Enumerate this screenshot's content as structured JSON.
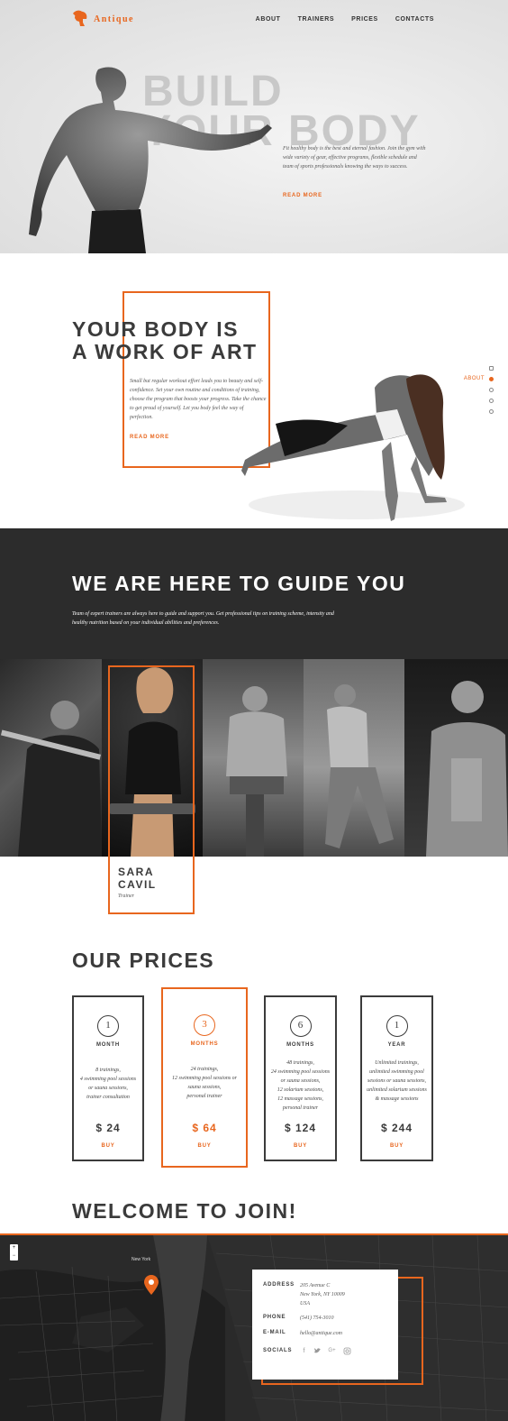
{
  "brand": {
    "name": "Antique",
    "accent": "#e8661e"
  },
  "nav": {
    "items": [
      "ABOUT",
      "TRAINERS",
      "PRICES",
      "CONTACTS"
    ]
  },
  "hero": {
    "line1": "BUILD",
    "line2": "YOUR BODY",
    "text": "Fit healthy body is the best and eternal fashion. Join the gym with wide variety of gear, effective programs, flexible schedule and team of sports professionals knowing the ways to success.",
    "read_more": "READ MORE"
  },
  "about": {
    "title_line1": "YOUR BODY IS",
    "title_line2": "A WORK OF ART",
    "text": "Small but regular workout effort leads you to beauty and self-confidence. Set your own routine and conditions of training, choose the program that boosts your progress. Take the chance to get proud of yourself. Let you body feel the way of perfection.",
    "read_more": "READ MORE",
    "section_nav_label": "ABOUT"
  },
  "guide": {
    "title": "WE ARE HERE TO GUIDE YOU",
    "text": "Team of expert trainers are always here to guide and support you. Get professional tips on training scheme, intensity and healthy nutrition based on your individual abilities and preferences."
  },
  "trainer": {
    "first": "SARA",
    "last": "CAVIL",
    "role": "Trainer"
  },
  "prices": {
    "title": "OUR PRICES",
    "plans": [
      {
        "num": "1",
        "unit": "MONTH",
        "features": "8 trainings,\n4 swimming pool sessions or sauna sessions,\ntrainer consultation",
        "price": "$ 24",
        "buy": "BUY"
      },
      {
        "num": "3",
        "unit": "MONTHS",
        "features": "24 trainings,\n12 swimming pool sessions or sauna sessions,\npersonal trainer",
        "price": "$ 64",
        "buy": "BUY"
      },
      {
        "num": "6",
        "unit": "MONTHS",
        "features": "48 trainings,\n24 swimming pool sessions or sauna sessions,\n12 solarium sessions,\n12 massage sessions,\npersonal trainer",
        "price": "$ 124",
        "buy": "BUY"
      },
      {
        "num": "1",
        "unit": "YEAR",
        "features": "Unlimited trainings,\nunlimited swimming pool sessions or sauna sessions,\nunlimited solarium sessions & massage sessions",
        "price": "$ 244",
        "buy": "BUY"
      }
    ]
  },
  "join": {
    "title": "WELCOME TO JOIN!",
    "map_city": "New York",
    "address_label": "ADDRESS",
    "address_1": "205 Avenue C",
    "address_2": "New York, NY 10009",
    "address_3": "USA",
    "phone_label": "PHONE",
    "phone": "(541) 754-3010",
    "email_label": "E-MAIL",
    "email": "hello@antique.com",
    "socials_label": "SOCIALS"
  }
}
